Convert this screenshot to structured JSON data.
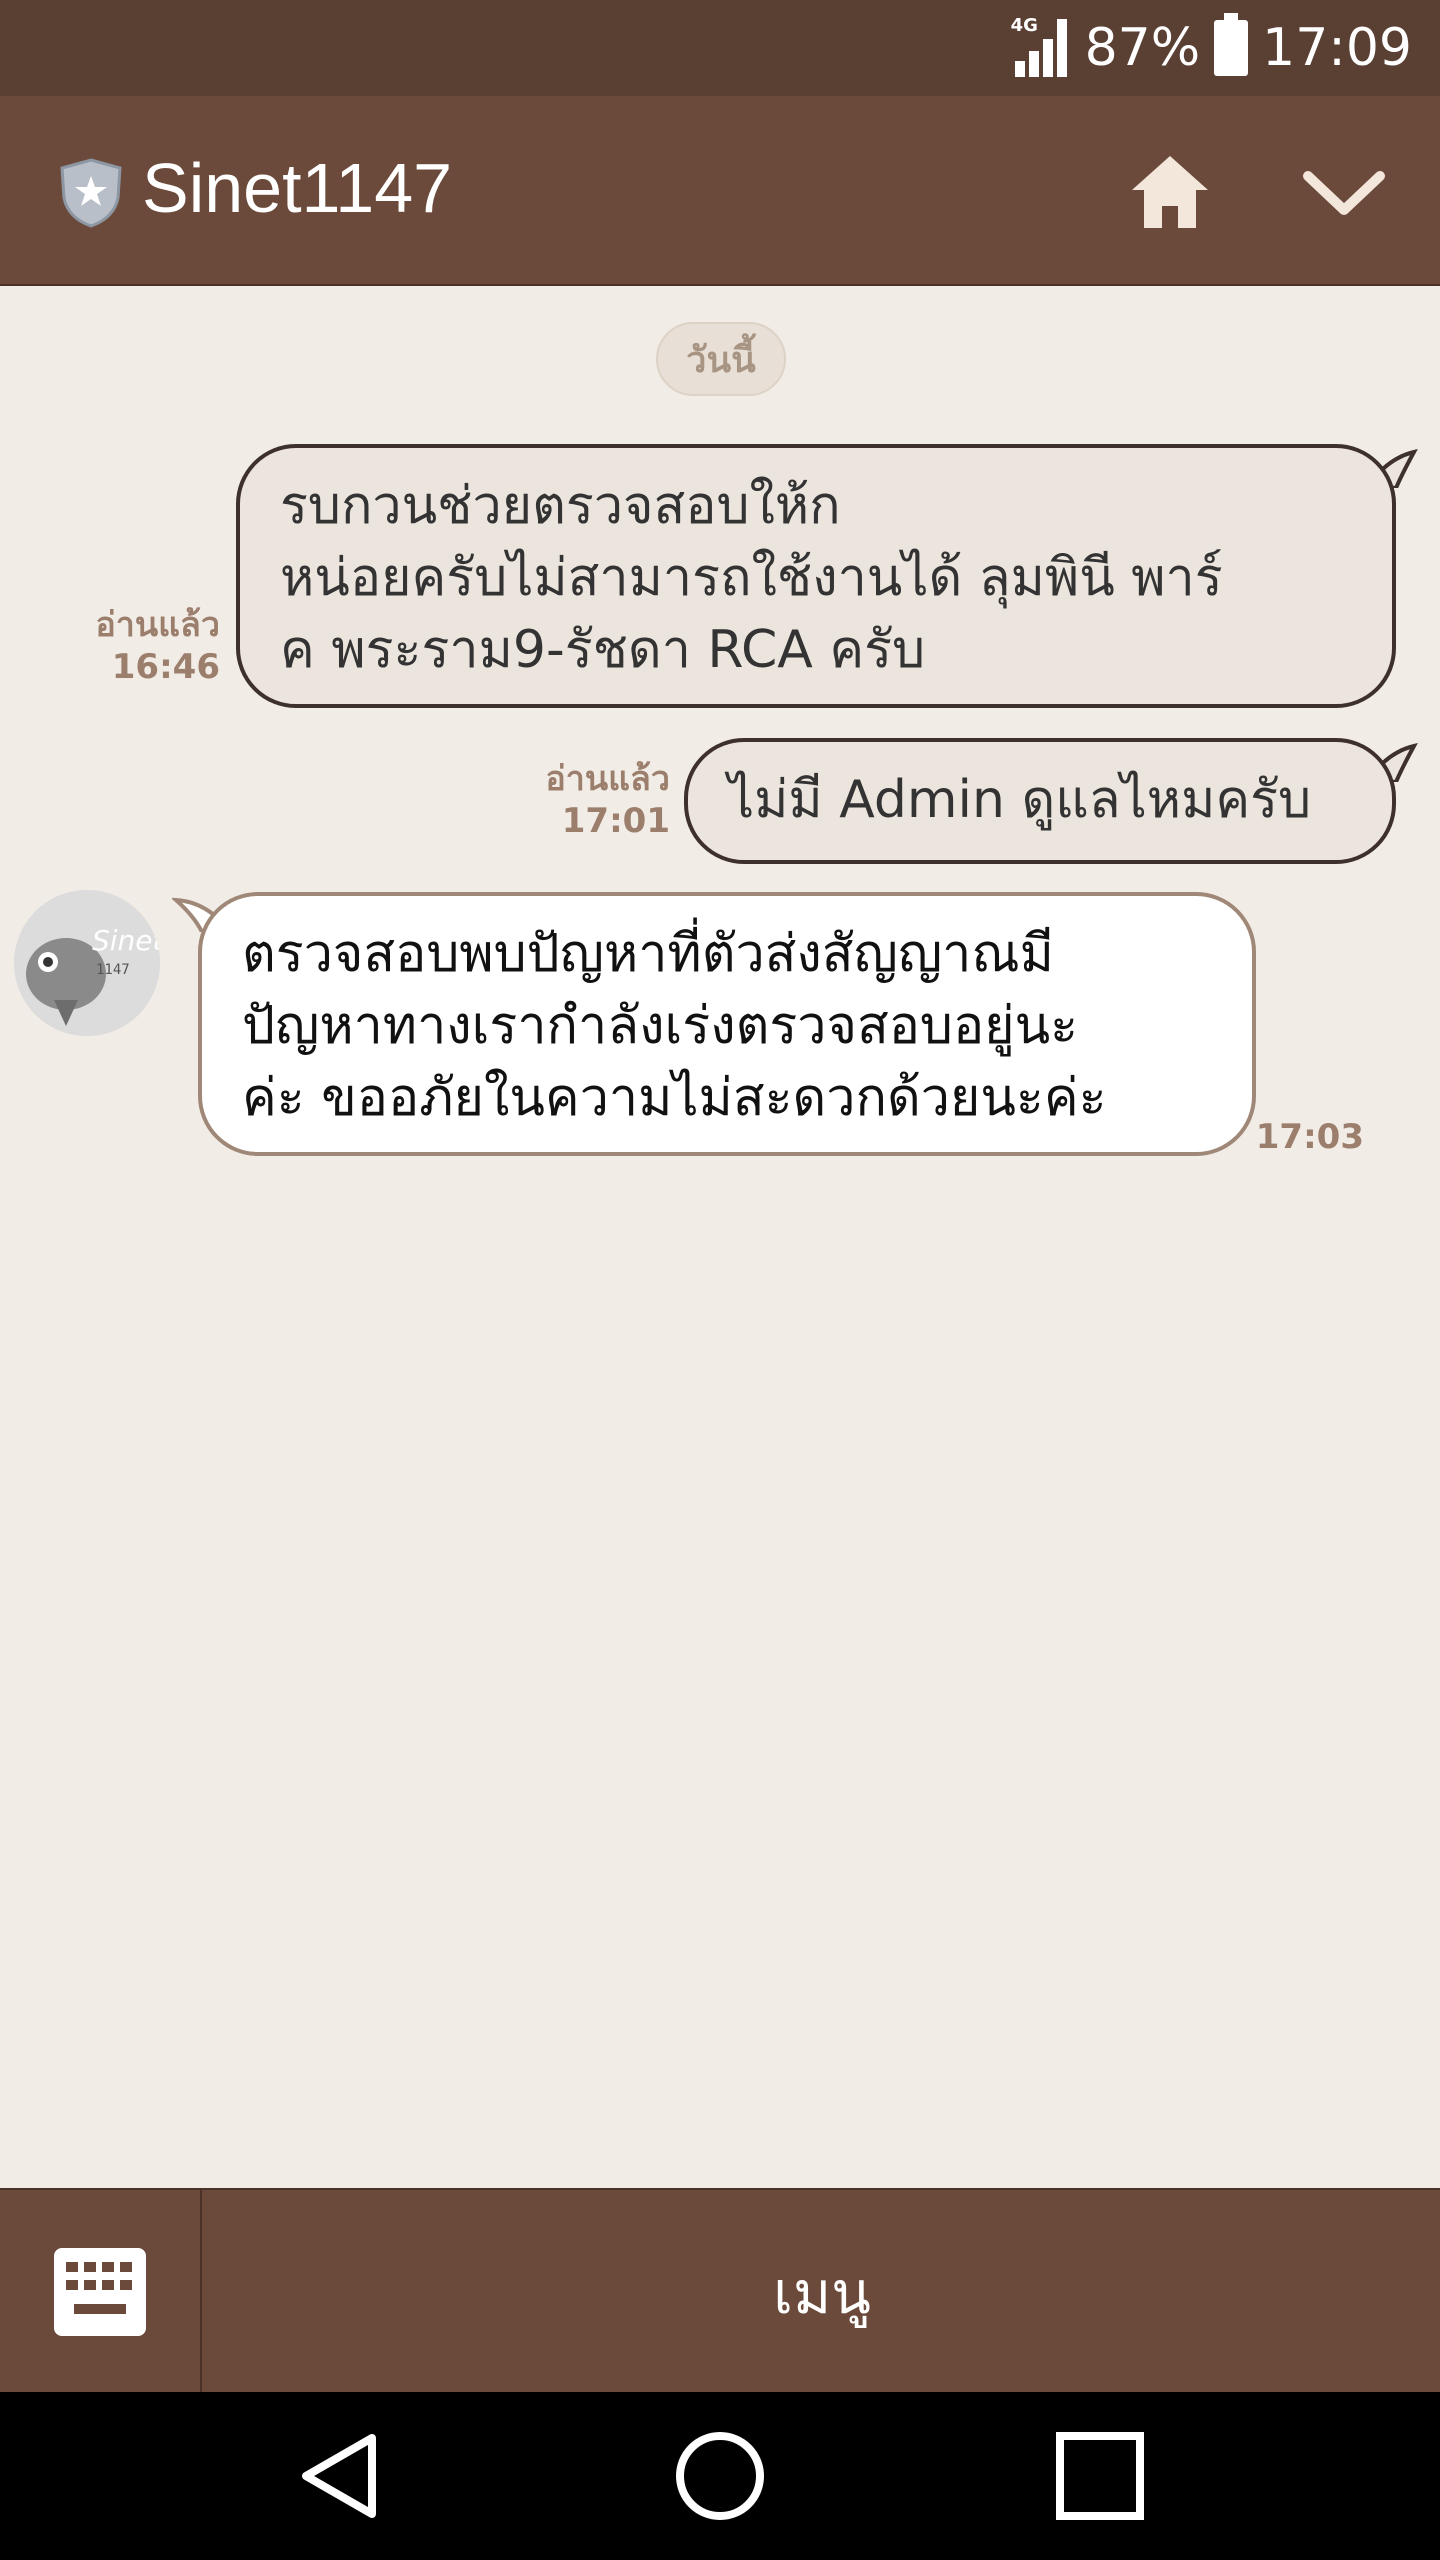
{
  "status_bar": {
    "network": "4G",
    "battery_percent": "87%",
    "time": "17:09"
  },
  "header": {
    "title": "Sinet1147",
    "icons": [
      "shield-star-icon",
      "home-icon",
      "chevron-down-icon"
    ]
  },
  "chat": {
    "date_label": "วันนี้",
    "messages": [
      {
        "direction": "outgoing",
        "lines": [
          "รบกวนช่วยตรวจสอบให้ก",
          "หน่อยครับไม่สามารถใช้งานได้ ลุมพินี พาร์",
          "ค พระราม9-รัชดา RCA ครับ"
        ],
        "read_label": "อ่านแล้ว",
        "time": "16:46"
      },
      {
        "direction": "outgoing",
        "lines": [
          "ไม่มี Admin ดูแลไหมครับ"
        ],
        "read_label": "อ่านแล้ว",
        "time": "17:01"
      },
      {
        "direction": "incoming",
        "lines": [
          "ตรวจสอบพบปัญหาที่ตัวส่งสัญญาณมี",
          "ปัญหาทางเรากำลังเร่งตรวจสอบอยู่นะ",
          "ค่ะ  ขออภัยในความไม่สะดวกด้วยนะค่ะ"
        ],
        "time": "17:03"
      }
    ]
  },
  "bottom_bar": {
    "menu_label": "เมนู"
  },
  "colors": {
    "status_bar": "#5a3f33",
    "header": "#6b4a3b",
    "chat_bg": "#f1ece6",
    "outgoing_bubble": "#ece5de",
    "incoming_bubble": "#ffffff",
    "meta_text": "#9b7e6c"
  }
}
